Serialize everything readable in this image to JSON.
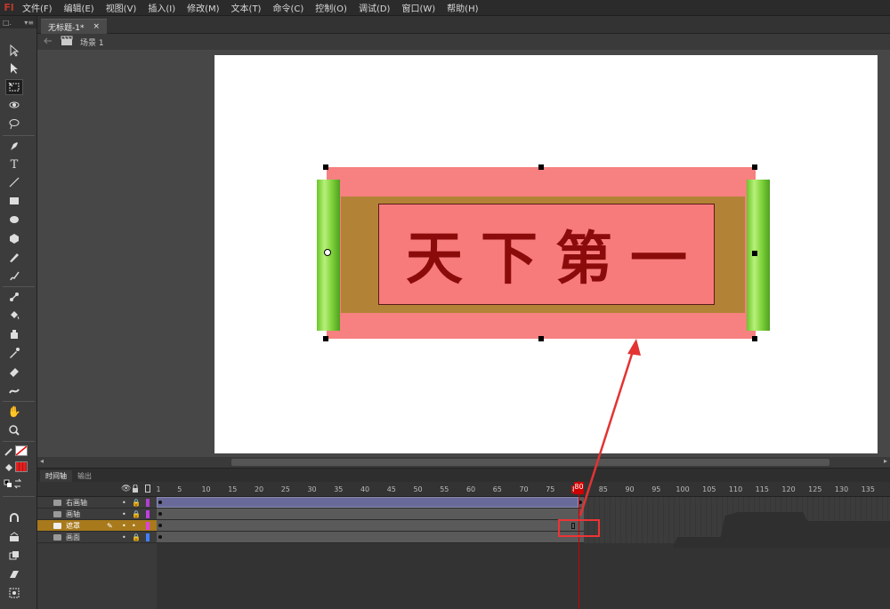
{
  "logo": "Fl",
  "menu": [
    "文件(F)",
    "编辑(E)",
    "视图(V)",
    "插入(I)",
    "修改(M)",
    "文本(T)",
    "命令(C)",
    "控制(O)",
    "调试(D)",
    "窗口(W)",
    "帮助(H)"
  ],
  "tools_panel": {
    "header_left": "□.",
    "header_right": "▾≡"
  },
  "document": {
    "tab_title": "无标题-1*",
    "tab_close": "×",
    "scene_label": "场景 1"
  },
  "stage": {
    "calligraphy": "天下第一",
    "bg_color": "#ffffff"
  },
  "timeline": {
    "tabs": [
      "时间轴",
      "输出"
    ],
    "ruler": [
      "1",
      "5",
      "10",
      "15",
      "20",
      "25",
      "30",
      "35",
      "40",
      "45",
      "50",
      "55",
      "60",
      "65",
      "70",
      "75",
      "80",
      "85",
      "90",
      "95",
      "100",
      "105",
      "110",
      "115",
      "120",
      "125",
      "130",
      "135"
    ],
    "current_frame": "80",
    "layers": [
      {
        "name": "右画轴",
        "color": "#b040d0",
        "selected": false
      },
      {
        "name": "画轴",
        "color": "#c040e0",
        "selected": false
      },
      {
        "name": "遮罩",
        "color": "#e040e0",
        "selected": true
      },
      {
        "name": "画面",
        "color": "#4080ff",
        "selected": false
      }
    ]
  },
  "colors": {
    "accent_red": "#e33333",
    "selected_layer": "#a87a1c",
    "tween": "#6a6a9a"
  }
}
